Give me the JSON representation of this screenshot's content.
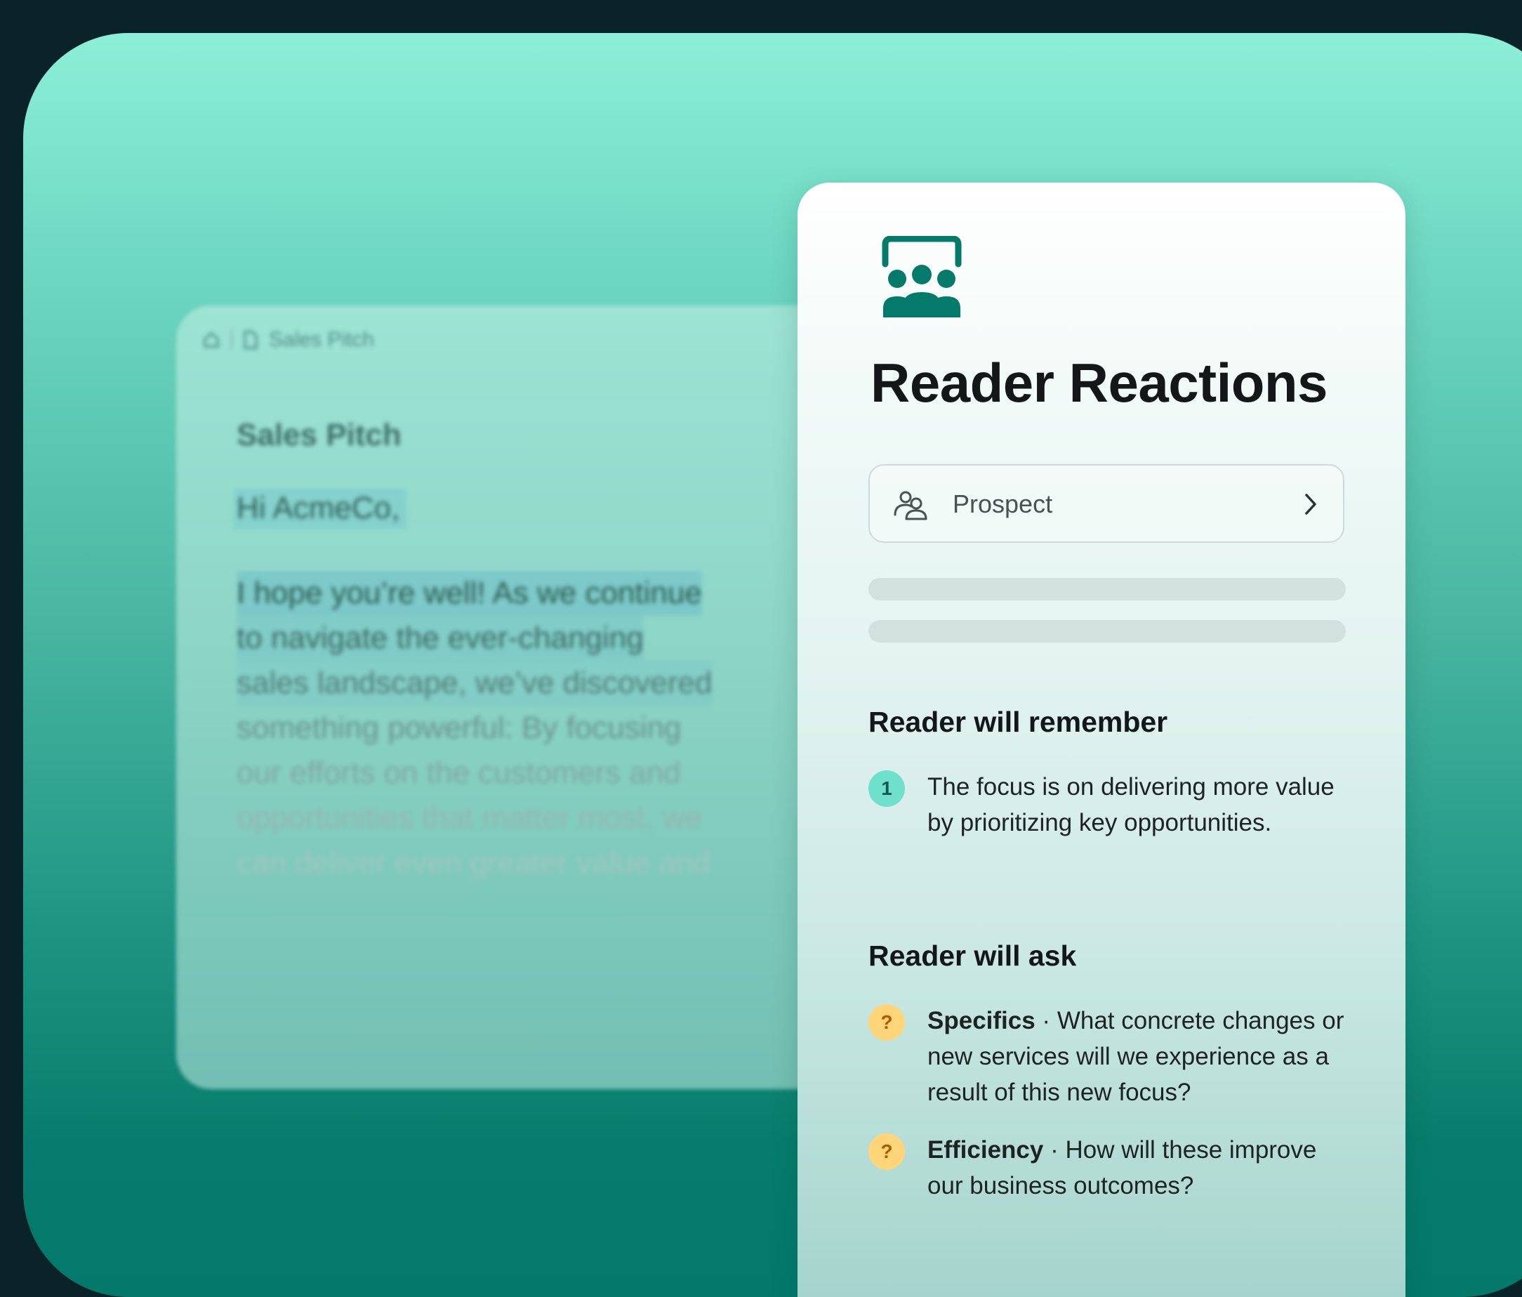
{
  "document": {
    "breadcrumb": "Sales Pitch",
    "title": "Sales Pitch",
    "greeting": "Hi AcmeCo,",
    "body_lines": [
      "I hope you’re well! As we continue",
      "to navigate the ever-changing",
      "sales landscape, we’ve discovered",
      "something powerful: By focusing",
      "our efforts on the customers and",
      "opportunities that matter most, we",
      "can deliver even greater value and"
    ]
  },
  "panel": {
    "title": "Reader Reactions",
    "persona": {
      "label": "Prospect"
    },
    "remember": {
      "heading": "Reader will remember",
      "items": [
        {
          "badge": "1",
          "text": "The focus is on delivering more value by prioritizing key opportunities."
        }
      ]
    },
    "ask": {
      "heading": "Reader will ask",
      "items": [
        {
          "badge": "?",
          "label": "Specifics",
          "separator": " · ",
          "text": "What concrete changes or new services will we experience as a result of this new focus?"
        },
        {
          "badge": "?",
          "label": "Efficiency",
          "separator": " · ",
          "text": "How will these improve our business outcomes?"
        }
      ]
    }
  },
  "colors": {
    "accent": "#047a6b",
    "badge_number": "#6fe0cb",
    "badge_question": "#ffd57a"
  },
  "icons": {
    "panel_icon": "audience-icon",
    "persona_icon": "people-icon",
    "chevron": "chevron-right-icon",
    "home": "home-icon",
    "file": "file-icon"
  }
}
